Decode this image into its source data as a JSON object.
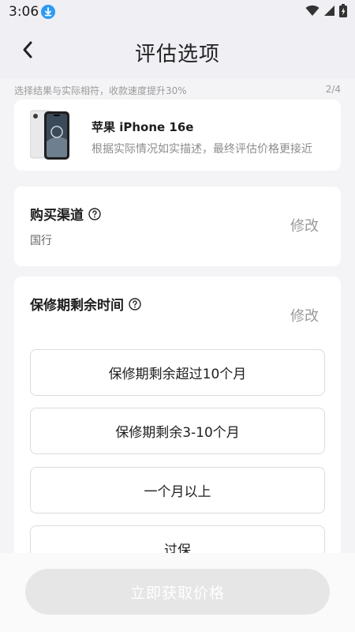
{
  "status_bar": {
    "time": "3:06",
    "icons": [
      "download-icon",
      "wifi-icon",
      "signal-icon",
      "battery-charging-icon"
    ]
  },
  "header": {
    "title": "评估选项",
    "back_icon": "chevron-left-icon"
  },
  "hint": {
    "text": "选择结果与实际相符，收款速度提升30%",
    "step": "2/4"
  },
  "product": {
    "name": "苹果 iPhone 16e",
    "description": "根据实际情况如实描述，最终评估价格更接近"
  },
  "purchase_channel": {
    "title": "购买渠道",
    "value": "国行",
    "modify_label": "修改"
  },
  "warranty": {
    "title": "保修期剩余时间",
    "modify_label": "修改",
    "options": [
      {
        "label": "保修期剩余超过10个月"
      },
      {
        "label": "保修期剩余3-10个月"
      },
      {
        "label": "一个月以上"
      },
      {
        "label": "过保"
      }
    ]
  },
  "footer": {
    "cta_label": "立即获取价格",
    "cta_enabled": false
  },
  "colors": {
    "accent_download": "#2b9bf4",
    "background": "#f4f4f6",
    "header_bg": "#f0eff4",
    "cta_disabled": "#e6e6e6"
  }
}
